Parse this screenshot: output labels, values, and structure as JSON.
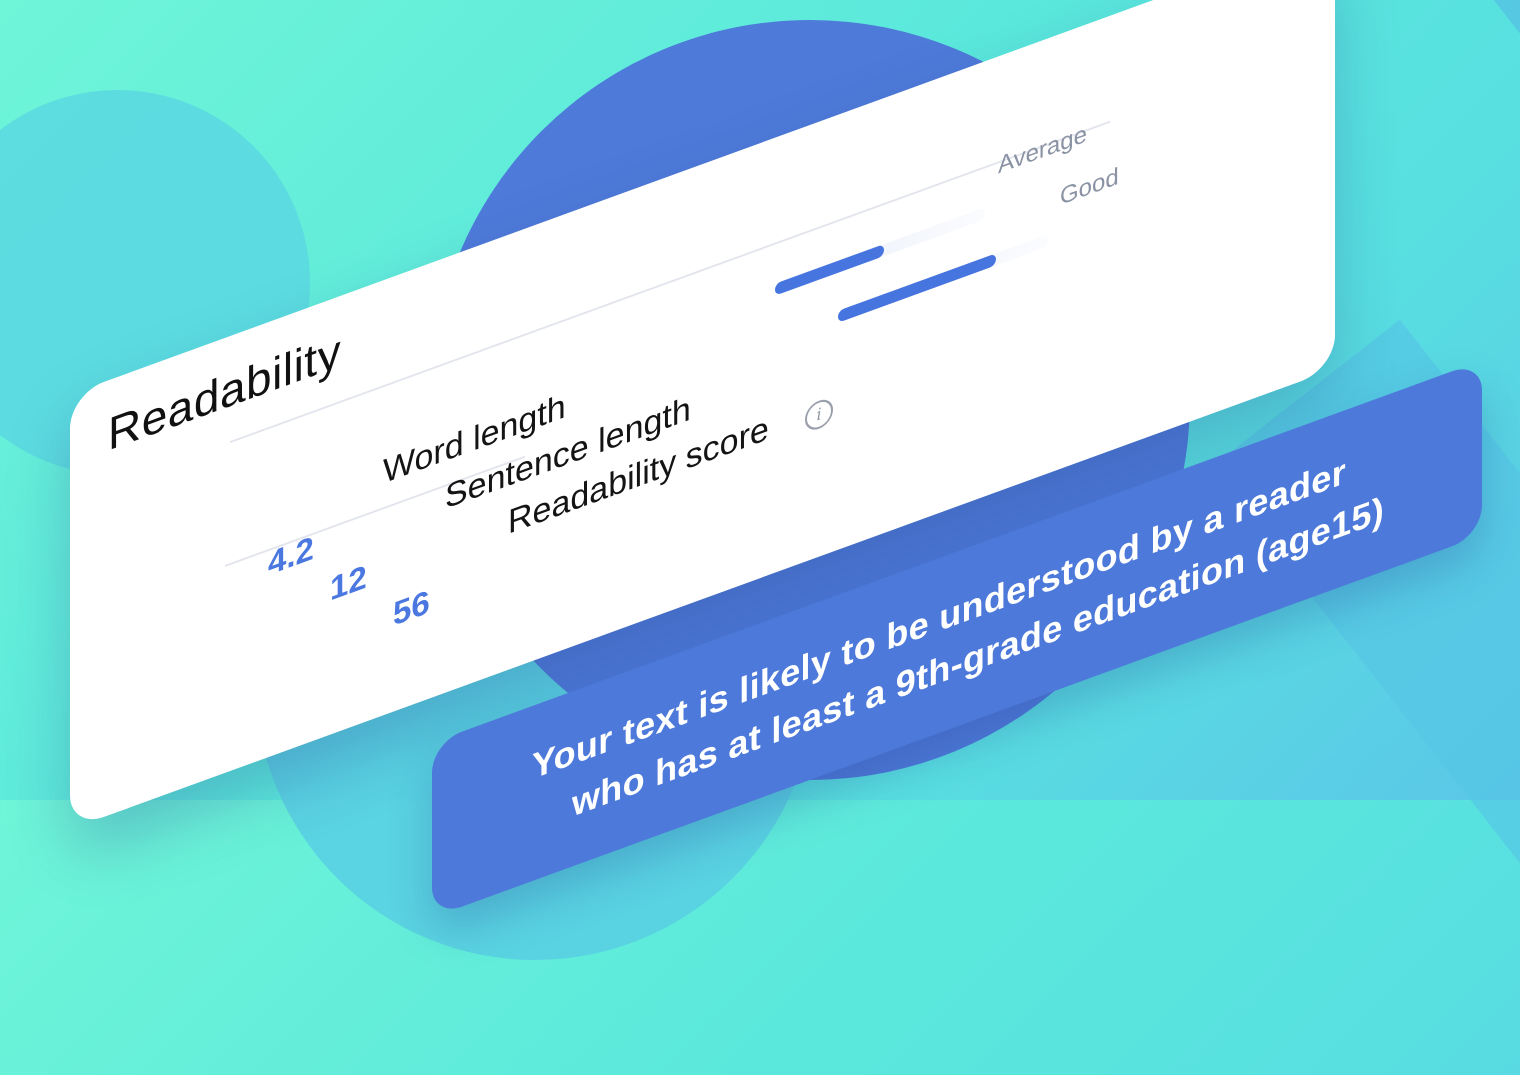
{
  "readability": {
    "title": "Readability",
    "metrics": [
      {
        "label": "Word length",
        "value": "4.2"
      },
      {
        "label": "Sentence length",
        "value": "12"
      },
      {
        "label": "Readability score",
        "value": "56"
      }
    ],
    "bars": [
      {
        "label": "Average",
        "fill": 0.52
      },
      {
        "label": "Good",
        "fill": 0.75
      }
    ],
    "accent_color": "#4a78e0"
  },
  "message": {
    "line1": "Your text is likely to be understood by a reader",
    "line2": "who has at least a 9th-grade education (age15)"
  },
  "icons": {
    "info": "info-icon"
  }
}
